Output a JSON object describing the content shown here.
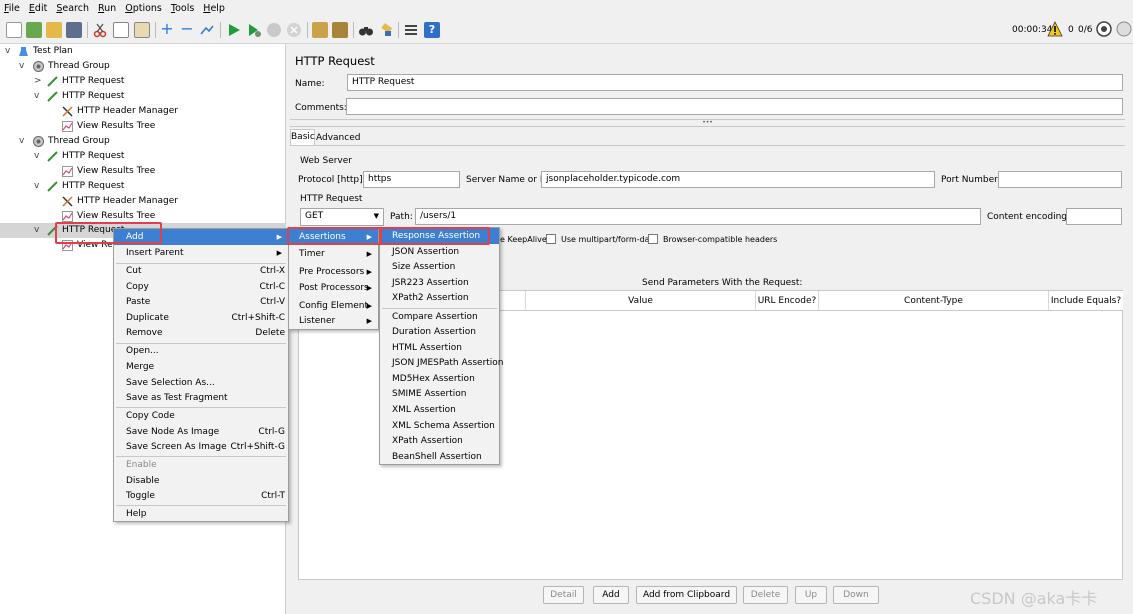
{
  "menubar": [
    "File",
    "Edit",
    "Search",
    "Run",
    "Options",
    "Tools",
    "Help"
  ],
  "status": {
    "elapsed": "00:00:34",
    "warnings": "0",
    "threads": "0/6"
  },
  "tree": [
    {
      "label": "Test Plan",
      "icon": "test-plan-icon"
    },
    {
      "label": "Thread Group",
      "icon": "thread-group-icon"
    },
    {
      "label": "HTTP Request",
      "icon": "sampler-pipette-icon"
    },
    {
      "label": "HTTP Request",
      "icon": "sampler-pipette-icon"
    },
    {
      "label": "HTTP Header Manager",
      "icon": "config-tools-icon"
    },
    {
      "label": "View Results Tree",
      "icon": "listener-chart-icon"
    },
    {
      "label": "Thread Group",
      "icon": "thread-group-icon"
    },
    {
      "label": "HTTP Request",
      "icon": "sampler-pipette-icon"
    },
    {
      "label": "View Results Tree",
      "icon": "listener-chart-icon"
    },
    {
      "label": "HTTP Request",
      "icon": "sampler-pipette-icon"
    },
    {
      "label": "HTTP Header Manager",
      "icon": "config-tools-icon"
    },
    {
      "label": "View Results Tree",
      "icon": "listener-chart-icon"
    },
    {
      "label": "HTTP Request",
      "icon": "sampler-pipette-icon"
    },
    {
      "label": "View Res",
      "icon": "listener-chart-icon"
    }
  ],
  "panel": {
    "title": "HTTP Request",
    "name_label": "Name:",
    "name_value": "HTTP Request",
    "comments_label": "Comments:",
    "tabs": [
      "Basic",
      "Advanced"
    ],
    "web_server": "Web Server",
    "protocol_label": "Protocol [http]:",
    "protocol_value": "https",
    "server_label": "Server Name or IP:",
    "server_value": "jsonplaceholder.typicode.com",
    "port_label": "Port Number:",
    "http_request": "HTTP Request",
    "method": "GET",
    "path_label": "Path:",
    "path_value": "/users/1",
    "encoding_label": "Content encoding:",
    "keepalive_label": "e KeepAlive",
    "multipart_label": "Use multipart/form-data",
    "browser_label": "Browser-compatible headers",
    "send_params": "Send Parameters With the Request:",
    "columns": [
      "Value",
      "URL Encode?",
      "Content-Type",
      "Include Equals?"
    ],
    "buttons": [
      "Detail",
      "Add",
      "Add from Clipboard",
      "Delete",
      "Up",
      "Down"
    ]
  },
  "context_menu": [
    {
      "label": "Add",
      "submenu": true
    },
    {
      "label": "Insert Parent",
      "submenu": true
    },
    {
      "label": "Cut",
      "shortcut": "Ctrl-X"
    },
    {
      "label": "Copy",
      "shortcut": "Ctrl-C"
    },
    {
      "label": "Paste",
      "shortcut": "Ctrl-V"
    },
    {
      "label": "Duplicate",
      "shortcut": "Ctrl+Shift-C"
    },
    {
      "label": "Remove",
      "shortcut": "Delete"
    },
    {
      "label": "Open..."
    },
    {
      "label": "Merge"
    },
    {
      "label": "Save Selection As..."
    },
    {
      "label": "Save as Test Fragment"
    },
    {
      "label": "Copy Code"
    },
    {
      "label": "Save Node As Image",
      "shortcut": "Ctrl-G"
    },
    {
      "label": "Save Screen As Image",
      "shortcut": "Ctrl+Shift-G"
    },
    {
      "label": "Enable"
    },
    {
      "label": "Disable"
    },
    {
      "label": "Toggle",
      "shortcut": "Ctrl-T"
    },
    {
      "label": "Help"
    }
  ],
  "add_menu": [
    "Assertions",
    "Timer",
    "Pre Processors",
    "Post Processors",
    "Config Element",
    "Listener"
  ],
  "assertions_menu": [
    "Response Assertion",
    "JSON Assertion",
    "Size Assertion",
    "JSR223 Assertion",
    "XPath2 Assertion",
    "Compare Assertion",
    "Duration Assertion",
    "HTML Assertion",
    "JSON JMESPath Assertion",
    "MD5Hex Assertion",
    "SMIME Assertion",
    "XML Assertion",
    "XML Schema Assertion",
    "XPath Assertion",
    "BeanShell Assertion"
  ],
  "watermark": "CSDN @aka卡卡",
  "colors": {
    "highlight": "#3d7fd1",
    "callout": "#e0404a",
    "selected_row": "#d5d5d5"
  }
}
